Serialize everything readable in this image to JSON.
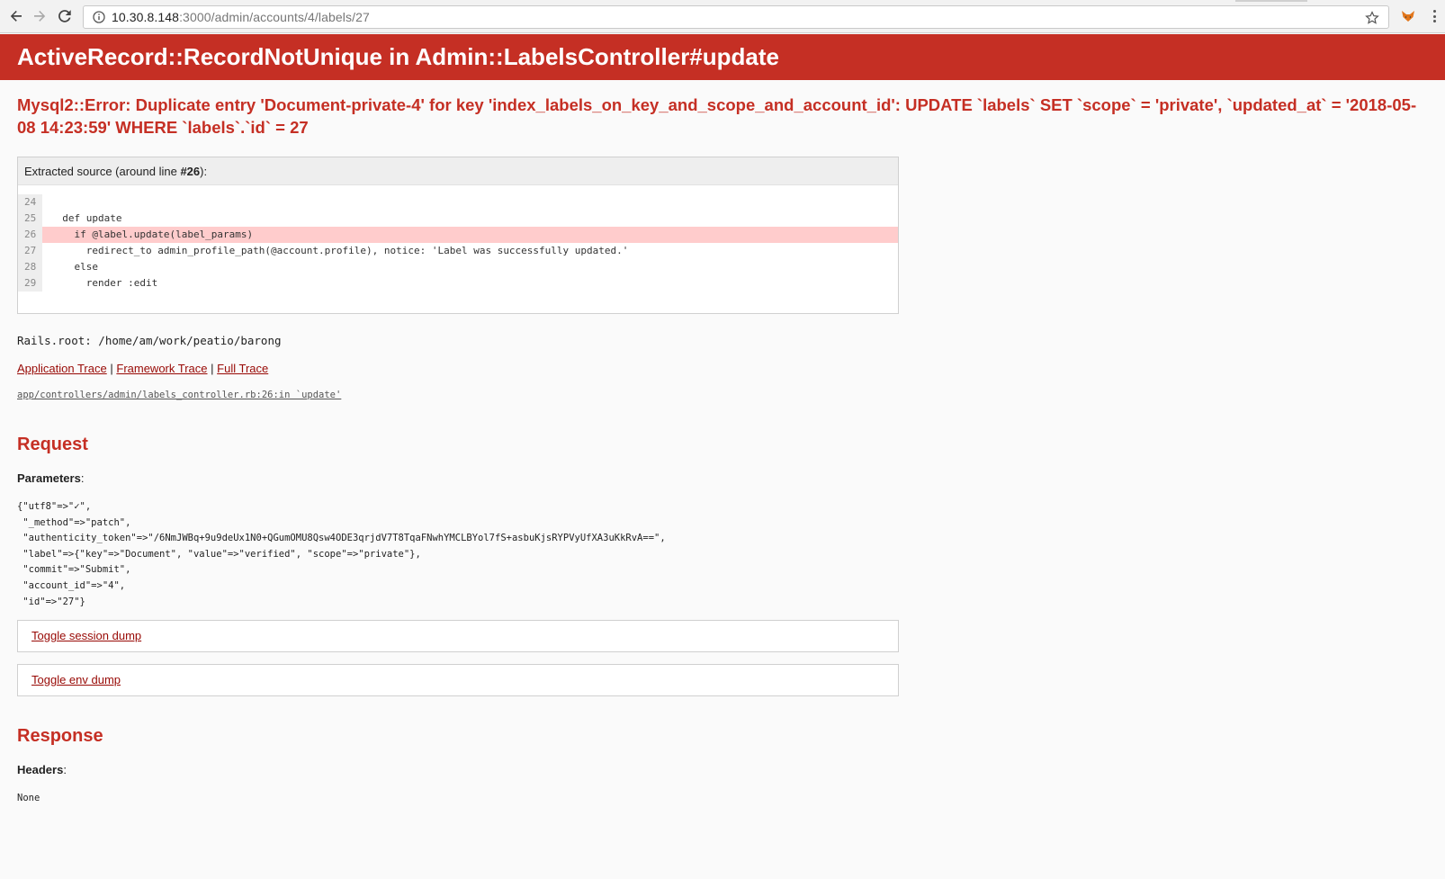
{
  "browser": {
    "url_host": "10.30.8.148",
    "url_rest": ":3000/admin/accounts/4/labels/27"
  },
  "page": {
    "title": "ActiveRecord::RecordNotUnique in Admin::LabelsController#update",
    "error_message": "Mysql2::Error: Duplicate entry 'Document-private-4' for key 'index_labels_on_key_and_scope_and_account_id': UPDATE `labels` SET `scope` = 'private', `updated_at` = '2018-05-08 14:23:59' WHERE `labels`.`id` = 27"
  },
  "source": {
    "header_prefix": "Extracted source (around line ",
    "header_line": "#26",
    "header_suffix": "):",
    "lines": [
      {
        "num": "24",
        "code": "",
        "highlight": false
      },
      {
        "num": "25",
        "code": "  def update",
        "highlight": false
      },
      {
        "num": "26",
        "code": "    if @label.update(label_params)",
        "highlight": true
      },
      {
        "num": "27",
        "code": "      redirect_to admin_profile_path(@account.profile), notice: 'Label was successfully updated.'",
        "highlight": false
      },
      {
        "num": "28",
        "code": "    else",
        "highlight": false
      },
      {
        "num": "29",
        "code": "      render :edit",
        "highlight": false
      }
    ]
  },
  "rails_root": "Rails.root: /home/am/work/peatio/barong",
  "trace": {
    "application": "Application Trace",
    "framework": "Framework Trace",
    "full": "Full Trace",
    "separator": "|",
    "first_line": "app/controllers/admin/labels_controller.rb:26:in `update'"
  },
  "request": {
    "heading": "Request",
    "params_label": "Parameters",
    "params_dump": "{\"utf8\"=>\"✓\",\n \"_method\"=>\"patch\",\n \"authenticity_token\"=>\"/6NmJWBq+9u9deUx1N0+QGumOMU8Qsw4ODE3qrjdV7T8TqaFNwhYMCLBYol7fS+asbuKjsRYPVyUfXA3uKkRvA==\",\n \"label\"=>{\"key\"=>\"Document\", \"value\"=>\"verified\", \"scope\"=>\"private\"},\n \"commit\"=>\"Submit\",\n \"account_id\"=>\"4\",\n \"id\"=>\"27\"}",
    "toggle_session": "Toggle session dump",
    "toggle_env": "Toggle env dump"
  },
  "response": {
    "heading": "Response",
    "headers_label": "Headers",
    "headers_value": "None"
  }
}
